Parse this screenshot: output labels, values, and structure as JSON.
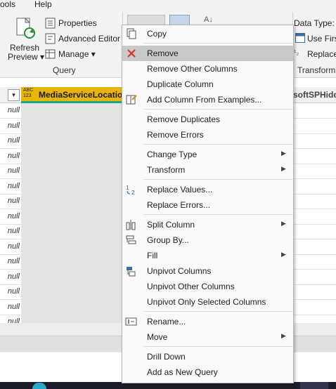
{
  "menubar": {
    "tools": "ools",
    "help": "Help"
  },
  "ribbon": {
    "refresh_preview_line1": "Refresh",
    "refresh_preview_line2": "Preview",
    "properties": "Properties",
    "advanced_editor": "Advanced Editor",
    "manage": "Manage",
    "query_group": "Query",
    "data_type": "Data Type: A",
    "use_first": "Use First",
    "replace": "Replace",
    "transform_group": "Transform"
  },
  "table": {
    "column_type": "ABC\n123",
    "column_type_top": "ABC",
    "column_type_bottom": "123",
    "column_name": "MediaServiceLocation",
    "next_column_partial": "softSPHidden",
    "null_value": "null",
    "row_count_visible": 15
  },
  "context_menu": {
    "items": [
      {
        "label": "Copy",
        "icon": "copy-icon"
      },
      {
        "label": "Remove",
        "icon": "remove-x-icon",
        "highlighted": true
      },
      {
        "label": "Remove Other Columns"
      },
      {
        "label": "Duplicate Column"
      },
      {
        "label": "Add Column From Examples...",
        "icon": "add-column-examples-icon"
      },
      {
        "label": "Remove Duplicates"
      },
      {
        "label": "Remove Errors"
      },
      {
        "label": "Change Type",
        "submenu": true
      },
      {
        "label": "Transform",
        "submenu": true
      },
      {
        "label": "Replace Values...",
        "icon": "replace-values-icon"
      },
      {
        "label": "Replace Errors..."
      },
      {
        "label": "Split Column",
        "icon": "split-column-icon",
        "submenu": true
      },
      {
        "label": "Group By...",
        "icon": "group-by-icon"
      },
      {
        "label": "Fill",
        "submenu": true
      },
      {
        "label": "Unpivot Columns",
        "icon": "unpivot-icon"
      },
      {
        "label": "Unpivot Other Columns"
      },
      {
        "label": "Unpivot Only Selected Columns"
      },
      {
        "label": "Rename...",
        "icon": "rename-icon"
      },
      {
        "label": "Move",
        "submenu": true
      },
      {
        "label": "Drill Down"
      },
      {
        "label": "Add as New Query"
      }
    ],
    "submenu_arrow": "▶"
  },
  "colors": {
    "highlight": "#c9c9c9",
    "column_header": "#e7b40a",
    "remove_x": "#d9342b"
  }
}
